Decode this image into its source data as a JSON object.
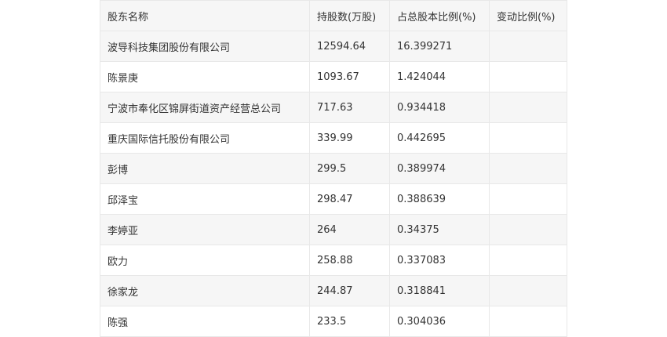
{
  "table": {
    "headers": [
      "股东名称",
      "持股数(万股)",
      "占总股本比例(%)",
      "变动比例(%)"
    ],
    "rows": [
      [
        "波导科技集团股份有限公司",
        "12594.64",
        "16.399271",
        ""
      ],
      [
        "陈景庚",
        "1093.67",
        "1.424044",
        ""
      ],
      [
        "宁波市奉化区锦屏街道资产经营总公司",
        "717.63",
        "0.934418",
        ""
      ],
      [
        "重庆国际信托股份有限公司",
        "339.99",
        "0.442695",
        ""
      ],
      [
        "彭博",
        "299.5",
        "0.389974",
        ""
      ],
      [
        "邱泽宝",
        "298.47",
        "0.388639",
        ""
      ],
      [
        "李婷亚",
        "264",
        "0.34375",
        ""
      ],
      [
        "欧力",
        "258.88",
        "0.337083",
        ""
      ],
      [
        "徐家龙",
        "244.87",
        "0.318841",
        ""
      ],
      [
        "陈强",
        "233.5",
        "0.304036",
        ""
      ]
    ]
  }
}
